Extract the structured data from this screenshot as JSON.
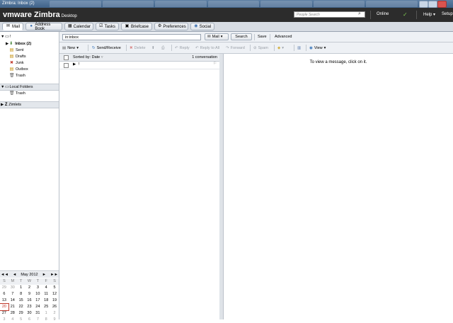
{
  "window": {
    "title": "Zimbra: Inbox (2)"
  },
  "header": {
    "logo_brand": "vmware",
    "logo_product": "Zimbra",
    "logo_suffix": "Desktop",
    "people_search_placeholder": "People Search",
    "status": "Online",
    "help": "Help",
    "setup": "Setup"
  },
  "tabs": [
    {
      "label": "Mail",
      "icon": "mail-icon"
    },
    {
      "label": "Address Book",
      "icon": "contacts-icon"
    },
    {
      "label": "Calendar",
      "icon": "calendar-icon"
    },
    {
      "label": "Tasks",
      "icon": "tasks-icon"
    },
    {
      "label": "Briefcase",
      "icon": "briefcase-icon"
    },
    {
      "label": "Preferences",
      "icon": "preferences-icon"
    },
    {
      "label": "Social",
      "icon": "social-icon"
    }
  ],
  "folders": {
    "account": "!",
    "items": [
      {
        "label": "Inbox (2)",
        "icon": "inbox-icon",
        "bold": true
      },
      {
        "label": "Sent",
        "icon": "sent-icon"
      },
      {
        "label": "Drafts",
        "icon": "drafts-icon"
      },
      {
        "label": "Junk",
        "icon": "junk-icon"
      },
      {
        "label": "Outbox",
        "icon": "outbox-icon"
      },
      {
        "label": "Trash",
        "icon": "trash-icon"
      }
    ],
    "local_header": "Local Folders",
    "local_items": [
      {
        "label": "Trash",
        "icon": "trash-icon"
      }
    ],
    "zimlets": "Zimlets"
  },
  "search": {
    "value": "in:inbox",
    "scope": "Mail",
    "search_button": "Search",
    "save_button": "Save",
    "advanced_button": "Advanced"
  },
  "toolbar": {
    "new": "New",
    "send_receive": "Send/Receive",
    "delete": "Delete",
    "reply": "Reply",
    "reply_all": "Reply to All",
    "forward": "Forward",
    "spam": "Spam",
    "view": "View"
  },
  "list": {
    "sort_label": "Sorted by: Date",
    "count": "1 conversation",
    "row_text": "!"
  },
  "reading_pane": {
    "message": "To view a message, click on it."
  },
  "calendar": {
    "month": "May 2012",
    "prev_year": "◄◄",
    "prev_month": "◄",
    "next_month": "►",
    "next_year": "►►",
    "weekdays": [
      "S",
      "M",
      "T",
      "W",
      "T",
      "F",
      "S"
    ],
    "weeks": [
      [
        "29",
        "30",
        "1",
        "2",
        "3",
        "4",
        "5"
      ],
      [
        "6",
        "7",
        "8",
        "9",
        "10",
        "11",
        "12"
      ],
      [
        "13",
        "14",
        "15",
        "16",
        "17",
        "18",
        "19"
      ],
      [
        "20",
        "21",
        "22",
        "23",
        "24",
        "25",
        "26"
      ],
      [
        "27",
        "28",
        "29",
        "30",
        "31",
        "1",
        "2"
      ],
      [
        "3",
        "4",
        "5",
        "6",
        "7",
        "8",
        "9"
      ]
    ],
    "today": "20"
  },
  "colors": {
    "header_bg": "#2c2c2c",
    "title_bar": "#4a6f97",
    "today": "#c0392b"
  }
}
